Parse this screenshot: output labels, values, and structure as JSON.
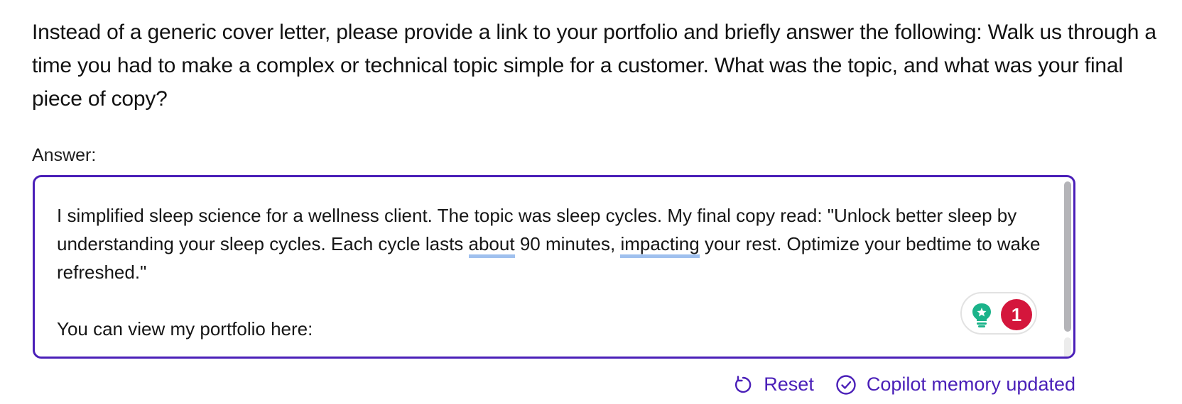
{
  "question": {
    "text": "Instead of a generic cover letter, please provide a link to your portfolio and briefly answer the following: Walk us through a time you had to make a complex or technical topic simple for a customer. What was the topic, and what was your final piece of copy?"
  },
  "answer": {
    "label": "Answer:",
    "line1_part1": "I simplified sleep science for a wellness client. The topic was sleep cycles. My final copy read: \"Unlock better sleep by understanding your sleep cycles. Each cycle lasts ",
    "spell_word_1": "about",
    "line1_part2": " 90 minutes, ",
    "spell_word_2": "impacting",
    "line1_part3": " your rest. Optimize your bedtime to wake refreshed.\"",
    "portfolio_prefix": "You can view my portfolio here:"
  },
  "grammar_widget": {
    "icon": "lightbulb-icon",
    "issue_count": "1",
    "badge_color": "#d4163c",
    "icon_color": "#1bb38a"
  },
  "actions": {
    "reset_label": "Reset",
    "memory_label": "Copilot memory updated"
  },
  "colors": {
    "accent": "#4a1fb8",
    "spell_underline": "#9fc0ee"
  }
}
